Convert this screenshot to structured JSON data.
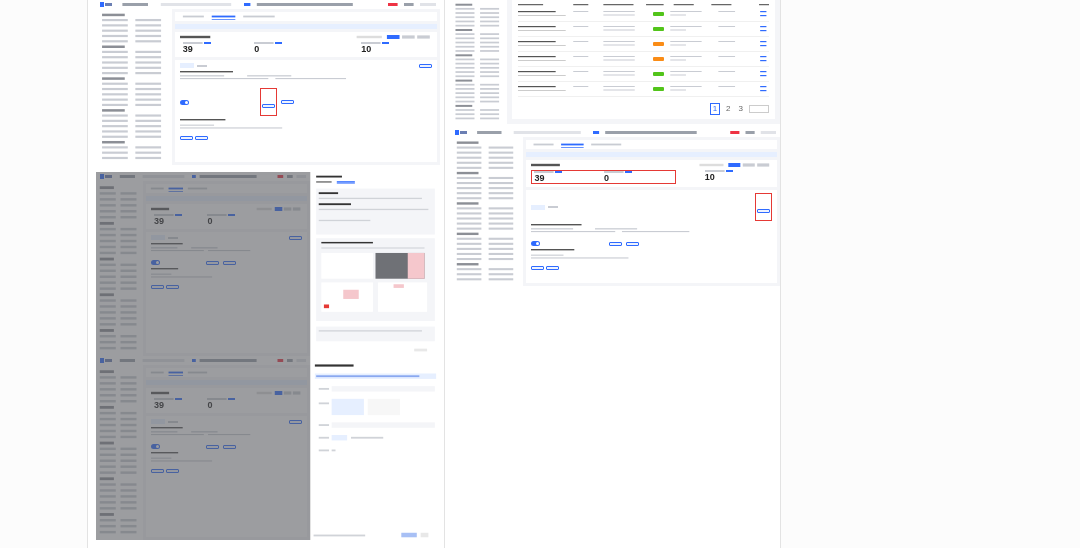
{
  "panels": [
    {
      "kind": "dashboard",
      "dimmed": false,
      "stats": [
        "39",
        "0",
        "10"
      ],
      "stats_highlighted": false,
      "button_highlighted": true,
      "toggle_on": true
    },
    {
      "kind": "table",
      "rows": [
        {
          "color": "#52c41a"
        },
        {
          "color": "#52c41a"
        },
        {
          "color": "#fa8c16"
        },
        {
          "color": "#fa8c16"
        },
        {
          "color": "#52c41a"
        },
        {
          "color": "#52c41a"
        }
      ],
      "pages": [
        {
          "label": "1",
          "selected": true
        },
        {
          "label": "2",
          "selected": false
        },
        {
          "label": "3",
          "selected": false
        }
      ]
    },
    {
      "kind": "dashboard",
      "dimmed": false,
      "stats": [
        "39",
        "0",
        "10"
      ],
      "stats_highlighted": true,
      "button_highlighted": true,
      "toggle_on": true
    },
    {
      "kind": "dashboard",
      "dimmed": true,
      "stats": [
        "39",
        "0"
      ],
      "stats_highlighted": false,
      "button_highlighted": false,
      "toggle_on": true
    },
    {
      "kind": "dashboard",
      "dimmed": true,
      "stats": [
        "39",
        "0"
      ],
      "stats_highlighted": false,
      "button_highlighted": false,
      "toggle_on": true
    },
    {
      "kind": "guide_dialog"
    },
    {
      "kind": "form_dialog"
    }
  ]
}
